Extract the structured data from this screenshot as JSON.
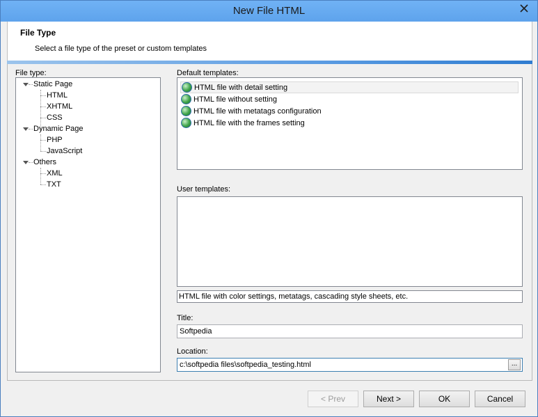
{
  "window": {
    "title": "New File HTML",
    "close_glyph": "close-icon"
  },
  "header": {
    "title": "File Type",
    "description": "Select a file type of the preset or custom templates"
  },
  "file_type": {
    "label": "File type:",
    "tree": [
      {
        "label": "Static Page",
        "children": [
          "HTML",
          "XHTML",
          "CSS"
        ]
      },
      {
        "label": "Dynamic Page",
        "children": [
          "PHP",
          "JavaScript"
        ]
      },
      {
        "label": "Others",
        "children": [
          "XML",
          "TXT"
        ]
      }
    ]
  },
  "default_templates": {
    "label": "Default templates:",
    "items": [
      "HTML file with detail setting",
      "HTML file without setting",
      "HTML file with metatags configuration",
      "HTML file with the frames setting"
    ],
    "selected_index": 0,
    "item_icon": "globe-icon"
  },
  "user_templates": {
    "label": "User templates:"
  },
  "description_text": "HTML file with color settings, metatags, cascading style sheets, etc.",
  "title_field": {
    "label": "Title:",
    "value": "Softpedia"
  },
  "location_field": {
    "label": "Location:",
    "value": "c:\\softpedia files\\softpedia_testing.html",
    "browse_label": "..."
  },
  "buttons": {
    "prev": "< Prev",
    "next": "Next >",
    "ok": "OK",
    "cancel": "Cancel"
  }
}
